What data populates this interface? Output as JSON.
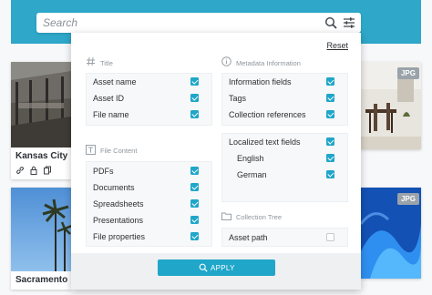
{
  "search": {
    "placeholder": "Search"
  },
  "cards": {
    "kansas_city": "Kansas City",
    "sacramento": "Sacramento",
    "badge_top": "JPG",
    "badge_bottom": "JPG"
  },
  "panel": {
    "reset": "Reset",
    "title_section": {
      "label": "Title",
      "items": [
        {
          "label": "Asset name",
          "checked": true
        },
        {
          "label": "Asset ID",
          "checked": true
        },
        {
          "label": "File name",
          "checked": true
        }
      ]
    },
    "file_content": {
      "label": "File Content",
      "items": [
        {
          "label": "PDFs",
          "checked": true
        },
        {
          "label": "Documents",
          "checked": true
        },
        {
          "label": "Spreadsheets",
          "checked": true
        },
        {
          "label": "Presentations",
          "checked": true
        },
        {
          "label": "File properties",
          "checked": true
        }
      ]
    },
    "metadata": {
      "label": "Metadata Information",
      "items": [
        {
          "label": "Information fields",
          "checked": true
        },
        {
          "label": "Tags",
          "checked": true
        },
        {
          "label": "Collection references",
          "checked": true
        }
      ],
      "localized": {
        "label": "Localized text fields",
        "checked": true
      },
      "languages": [
        {
          "label": "English",
          "checked": true
        },
        {
          "label": "German",
          "checked": true
        }
      ]
    },
    "collection_tree": {
      "label": "Collection Tree",
      "items": [
        {
          "label": "Asset path",
          "checked": false
        }
      ]
    },
    "apply": "APPLY"
  },
  "colors": {
    "accent": "#1fa6c9",
    "topbar": "#2ea7c9"
  }
}
